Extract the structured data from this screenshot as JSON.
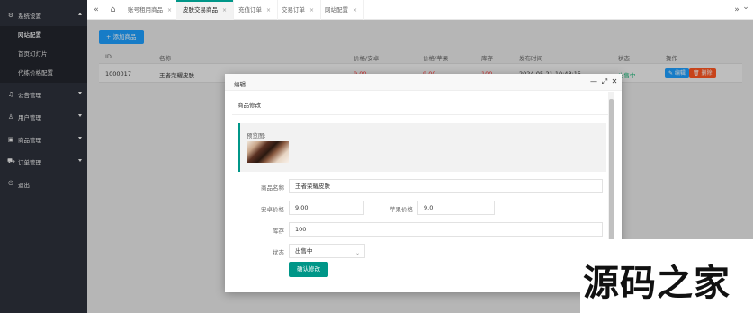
{
  "sidebar": {
    "groups": [
      {
        "label": "系统设置",
        "icon": "gear-icon",
        "glyph": "⚙"
      },
      {
        "label": "公告管理",
        "icon": "bell-icon",
        "glyph": "♫"
      },
      {
        "label": "用户管理",
        "icon": "user-icon",
        "glyph": "♙"
      },
      {
        "label": "商品管理",
        "icon": "box-icon",
        "glyph": "▣"
      },
      {
        "label": "订单管理",
        "icon": "cart-icon",
        "glyph": "⛟"
      },
      {
        "label": "退出",
        "icon": "power-icon",
        "glyph": "⏻"
      }
    ],
    "sub_items": [
      "网站配置",
      "首页幻灯片",
      "代练价格配置"
    ]
  },
  "topbar": {
    "left_btn": "«",
    "home_icon": "⌂",
    "right_btn": "»",
    "down_btn": "⌄",
    "tabs": [
      {
        "label": "账号租用商品"
      },
      {
        "label": "皮肤交易商品"
      },
      {
        "label": "充值订单"
      },
      {
        "label": "交易订单"
      },
      {
        "label": "网站配置"
      }
    ]
  },
  "main": {
    "add_button": "+ 添加商品",
    "table": {
      "headers": [
        "ID",
        "名称",
        "价格/安卓",
        "价格/苹果",
        "库存",
        "发布时间",
        "状态",
        "操作"
      ],
      "row": {
        "id": "1000017",
        "name": "王者荣耀皮肤",
        "price_android": "9.00",
        "price_ios": "9.00",
        "stock": "100",
        "time": "2024-05-21 10:48:15",
        "status": "出售中",
        "edit": "✎ 编辑",
        "delete": "🗑 删除"
      }
    }
  },
  "modal": {
    "title": "编辑",
    "min_icon": "—",
    "max_icon": "⤢",
    "close_icon": "✕",
    "card_title": "商品修改",
    "preview_label": "预览图:",
    "fields": {
      "name_label": "商品名称",
      "name_value": "王者荣耀皮肤",
      "android_label": "安卓价格",
      "android_value": "9.00",
      "ios_label": "苹果价格",
      "ios_value": "9.0",
      "stock_label": "库存",
      "stock_value": "100",
      "status_label": "状态",
      "status_value": "出售中",
      "status_arrow": "⌄"
    },
    "submit": "确认修改"
  },
  "watermark": "源码之家",
  "colors": {
    "sidebar_bg": "#23262e",
    "accent": "#009688",
    "primary": "#1e9fff",
    "danger": "#ff5722",
    "price_red": "#ff3b3b",
    "status_green": "#16b777"
  }
}
